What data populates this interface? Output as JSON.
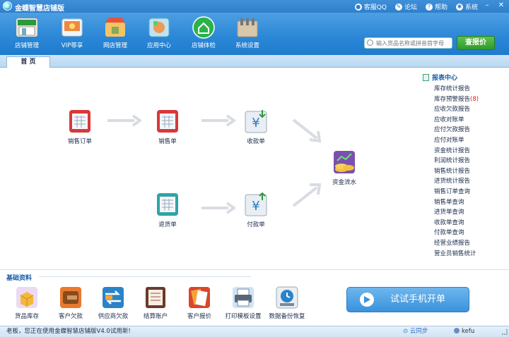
{
  "app": {
    "title": "金蝶智慧店铺版"
  },
  "title_links": [
    {
      "label": "客服QQ",
      "icon": "qq-icon"
    },
    {
      "label": "论坛",
      "icon": "forum-icon"
    },
    {
      "label": "帮助",
      "icon": "help-icon"
    },
    {
      "label": "系统",
      "icon": "gear-icon"
    }
  ],
  "toolbar": [
    {
      "label": "店铺管理",
      "icon": "store-icon"
    },
    {
      "label": "VIP尊享",
      "icon": "vip-icon"
    },
    {
      "label": "网店管理",
      "icon": "online-store-icon"
    },
    {
      "label": "应用中心",
      "icon": "app-center-icon"
    },
    {
      "label": "店铺体检",
      "icon": "checkup-icon"
    },
    {
      "label": "系统设置",
      "icon": "settings-icon"
    }
  ],
  "search": {
    "placeholder": "输入货品名称或拼音首字母",
    "button": "查报价"
  },
  "tabs": [
    {
      "label": "首 页"
    }
  ],
  "flow": [
    {
      "label": "销售订单",
      "icon": "sales-order-icon"
    },
    {
      "label": "销售单",
      "icon": "sales-slip-icon"
    },
    {
      "label": "收款单",
      "icon": "receipt-icon"
    },
    {
      "label": "退货单",
      "icon": "return-slip-icon"
    },
    {
      "label": "付款单",
      "icon": "payment-icon"
    },
    {
      "label": "资金流水",
      "icon": "cash-flow-icon"
    }
  ],
  "reports": {
    "title": "报表中心",
    "items": [
      {
        "label": "库存统计报告",
        "badge": ""
      },
      {
        "label": "库存预警报告",
        "badge": "(8)"
      },
      {
        "label": "应收欠款报告",
        "badge": ""
      },
      {
        "label": "应收对账单",
        "badge": ""
      },
      {
        "label": "应付欠款报告",
        "badge": ""
      },
      {
        "label": "应付对账单",
        "badge": ""
      },
      {
        "label": "资金统计报告",
        "badge": ""
      },
      {
        "label": "利润统计报告",
        "badge": ""
      },
      {
        "label": "销售统计报告",
        "badge": ""
      },
      {
        "label": "进货统计报告",
        "badge": ""
      },
      {
        "label": "销售订单查询",
        "badge": ""
      },
      {
        "label": "销售单查询",
        "badge": ""
      },
      {
        "label": "进货单查询",
        "badge": ""
      },
      {
        "label": "收款单查询",
        "badge": ""
      },
      {
        "label": "付款单查询",
        "badge": ""
      },
      {
        "label": "经营业绩报告",
        "badge": ""
      },
      {
        "label": "营业员销售统计",
        "badge": ""
      }
    ]
  },
  "base": {
    "title": "基础资料",
    "items": [
      {
        "label": "货品库存",
        "icon": "inventory-icon"
      },
      {
        "label": "客户欠款",
        "icon": "customer-debt-icon"
      },
      {
        "label": "供应商欠款",
        "icon": "supplier-debt-icon"
      },
      {
        "label": "结算账户",
        "icon": "account-icon"
      },
      {
        "label": "客户报价",
        "icon": "quote-icon"
      },
      {
        "label": "打印模板设置",
        "icon": "printer-icon"
      },
      {
        "label": "数据备份恢复",
        "icon": "backup-icon"
      }
    ],
    "mobile_button": "试试手机开单"
  },
  "status": {
    "text": "老板，您正在使用金蝶智慧店铺版V4.0试用新!",
    "sync": "云同步",
    "user": "kefu"
  },
  "colors": {
    "titlebar": "#2f7fcc",
    "accent": "#1b5ca8",
    "search_btn": "#3aa531",
    "badge": "#dd2222"
  }
}
